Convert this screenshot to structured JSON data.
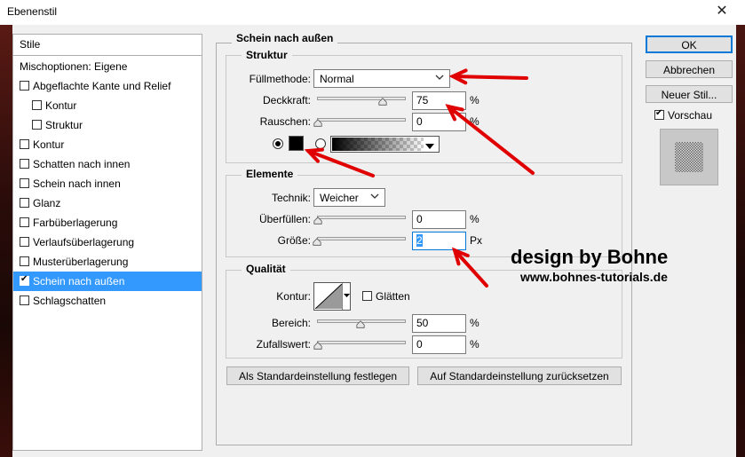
{
  "window": {
    "title": "Ebenenstil",
    "close_glyph": "✕"
  },
  "sidebar": {
    "header": "Stile",
    "blend_options": "Mischoptionen: Eigene",
    "items": [
      {
        "label": "Abgeflachte Kante und Relief",
        "checked": false,
        "indent": 0
      },
      {
        "label": "Kontur",
        "checked": false,
        "indent": 1
      },
      {
        "label": "Struktur",
        "checked": false,
        "indent": 1
      },
      {
        "label": "Kontur",
        "checked": false,
        "indent": 0
      },
      {
        "label": "Schatten nach innen",
        "checked": false,
        "indent": 0
      },
      {
        "label": "Schein nach innen",
        "checked": false,
        "indent": 0
      },
      {
        "label": "Glanz",
        "checked": false,
        "indent": 0
      },
      {
        "label": "Farbüberlagerung",
        "checked": false,
        "indent": 0
      },
      {
        "label": "Verlaufsüberlagerung",
        "checked": false,
        "indent": 0
      },
      {
        "label": "Musterüberlagerung",
        "checked": false,
        "indent": 0
      },
      {
        "label": "Schein nach außen",
        "checked": true,
        "indent": 0,
        "selected": true
      },
      {
        "label": "Schlagschatten",
        "checked": false,
        "indent": 0
      }
    ]
  },
  "panel": {
    "title": "Schein nach außen",
    "struktur": {
      "title": "Struktur",
      "blend_mode_label": "Füllmethode:",
      "blend_mode_value": "Normal",
      "opacity_label": "Deckkraft:",
      "opacity_value": "75",
      "noise_label": "Rauschen:",
      "noise_value": "0",
      "percent": "%",
      "color": "#000000"
    },
    "elemente": {
      "title": "Elemente",
      "technique_label": "Technik:",
      "technique_value": "Weicher",
      "spread_label": "Überfüllen:",
      "spread_value": "0",
      "size_label": "Größe:",
      "size_value": "2",
      "percent": "%",
      "px": "Px"
    },
    "qualitaet": {
      "title": "Qualität",
      "contour_label": "Kontur:",
      "smooth_label": "Glätten",
      "range_label": "Bereich:",
      "range_value": "50",
      "jitter_label": "Zufallswert:",
      "jitter_value": "0",
      "percent": "%"
    },
    "btn_default": "Als Standardeinstellung festlegen",
    "btn_reset": "Auf Standardeinstellung zurücksetzen"
  },
  "buttons": {
    "ok": "OK",
    "cancel": "Abbrechen",
    "new_style": "Neuer Stil...",
    "preview": "Vorschau"
  },
  "watermark": {
    "line1": "design by Bohne",
    "line2": "www.bohnes-tutorials.de"
  },
  "slider_levels": {
    "opacity": 0.75,
    "noise": 0,
    "spread": 0,
    "size": 0.01,
    "range": 0.5,
    "jitter": 0
  },
  "colors": {
    "selection": "#3399ff",
    "arrow": "#e00000"
  }
}
